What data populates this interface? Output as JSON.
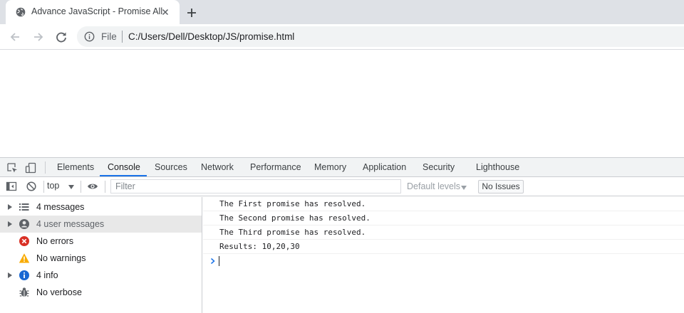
{
  "browser": {
    "tab_title": "Advance JavaScript - Promise All",
    "omnibox_scheme": "File",
    "url": "C:/Users/Dell/Desktop/JS/promise.html"
  },
  "devtools": {
    "tabs": [
      "Elements",
      "Console",
      "Sources",
      "Network",
      "Performance",
      "Memory",
      "Application",
      "Security",
      "Lighthouse"
    ],
    "active_tab": "Console",
    "context": "top",
    "filter_placeholder": "Filter",
    "levels_label": "Default levels",
    "issues_label": "No Issues",
    "sidebar": [
      {
        "label": "4 messages",
        "icon": "list-icon",
        "expandable": true,
        "selected": false
      },
      {
        "label": "4 user messages",
        "icon": "user-icon",
        "expandable": true,
        "selected": true
      },
      {
        "label": "No errors",
        "icon": "error-icon",
        "expandable": false,
        "selected": false
      },
      {
        "label": "No warnings",
        "icon": "warning-icon",
        "expandable": false,
        "selected": false
      },
      {
        "label": "4 info",
        "icon": "info-icon",
        "expandable": true,
        "selected": false
      },
      {
        "label": "No verbose",
        "icon": "verbose-icon",
        "expandable": false,
        "selected": false
      }
    ],
    "console_lines": [
      "The First promise has resolved.",
      "The Second promise has resolved.",
      "The Third promise has resolved.",
      "Results: 10,20,30"
    ]
  },
  "colors": {
    "accent": "#1a73e8",
    "error": "#d93025",
    "warning": "#f9ab00",
    "info": "#1967d2"
  }
}
